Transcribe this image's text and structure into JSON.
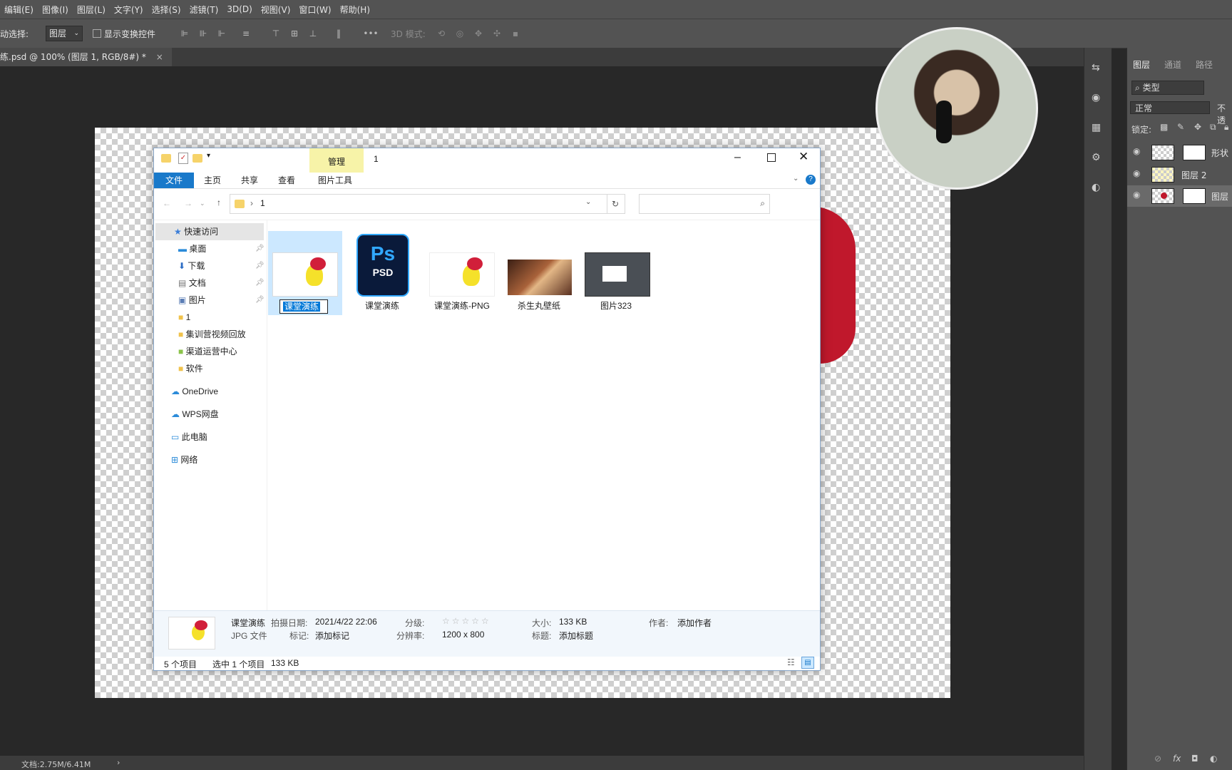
{
  "menubar": {
    "items": [
      "编辑(E)",
      "图像(I)",
      "图层(L)",
      "文字(Y)",
      "选择(S)",
      "滤镜(T)",
      "3D(D)",
      "视图(V)",
      "窗口(W)",
      "帮助(H)"
    ]
  },
  "options": {
    "auto_select_label": "动选择:",
    "auto_select_value": "图层",
    "show_transform_label": "显示变换控件",
    "mode_3d_label": "3D 模式:"
  },
  "document_tab": {
    "title": "练.psd @ 100% (图层 1, RGB/8#) *",
    "close": "×"
  },
  "layers_panel": {
    "tabs": [
      "图层",
      "通道",
      "路径"
    ],
    "filter": "类型",
    "blend_mode": "正常",
    "opacity_label": "不透",
    "lock_label": "锁定:",
    "layers": [
      {
        "name": "形状"
      },
      {
        "name": "图层 2"
      },
      {
        "name": "图层"
      }
    ]
  },
  "statusbar": {
    "doc_info": "文档:2.75M/6.41M",
    "arrow": "›"
  },
  "explorer": {
    "title_path": "1",
    "manage_tab": "管理",
    "ribbon_tabs": {
      "file": "文件",
      "home": "主页",
      "share": "共享",
      "view": "查看",
      "picture_tools": "图片工具"
    },
    "address": "1",
    "sidebar": {
      "quick_access": "快速访问",
      "items": [
        "桌面",
        "下载",
        "文档",
        "图片",
        "1",
        "集训营视频回放",
        "渠道运营中心",
        "软件"
      ],
      "onedrive": "OneDrive",
      "wps": "WPS网盘",
      "this_pc": "此电脑",
      "network": "网络"
    },
    "files": [
      {
        "name": "课堂演练",
        "renaming": true
      },
      {
        "name": "课堂演练",
        "thumb_text": "Ps",
        "thumb_sub": "PSD"
      },
      {
        "name": "课堂演练-PNG"
      },
      {
        "name": "杀生丸壁纸"
      },
      {
        "name": "图片323"
      }
    ],
    "details": {
      "file_name": "课堂演练",
      "file_type": "JPG 文件",
      "date_label": "拍摄日期:",
      "date_value": "2021/4/22 22:06",
      "tag_label": "标记:",
      "tag_value": "添加标记",
      "rating_label": "分级:",
      "rating_stars": "☆☆☆☆☆",
      "resolution_label": "分辨率:",
      "resolution_value": "1200 x 800",
      "size_label": "大小:",
      "size_value": "133 KB",
      "title_label": "标题:",
      "title_value": "添加标题",
      "author_label": "作者:",
      "author_value": "添加作者"
    },
    "status": {
      "item_count": "5 个项目",
      "selected": "选中 1 个项目",
      "selected_size": "133 KB"
    }
  }
}
